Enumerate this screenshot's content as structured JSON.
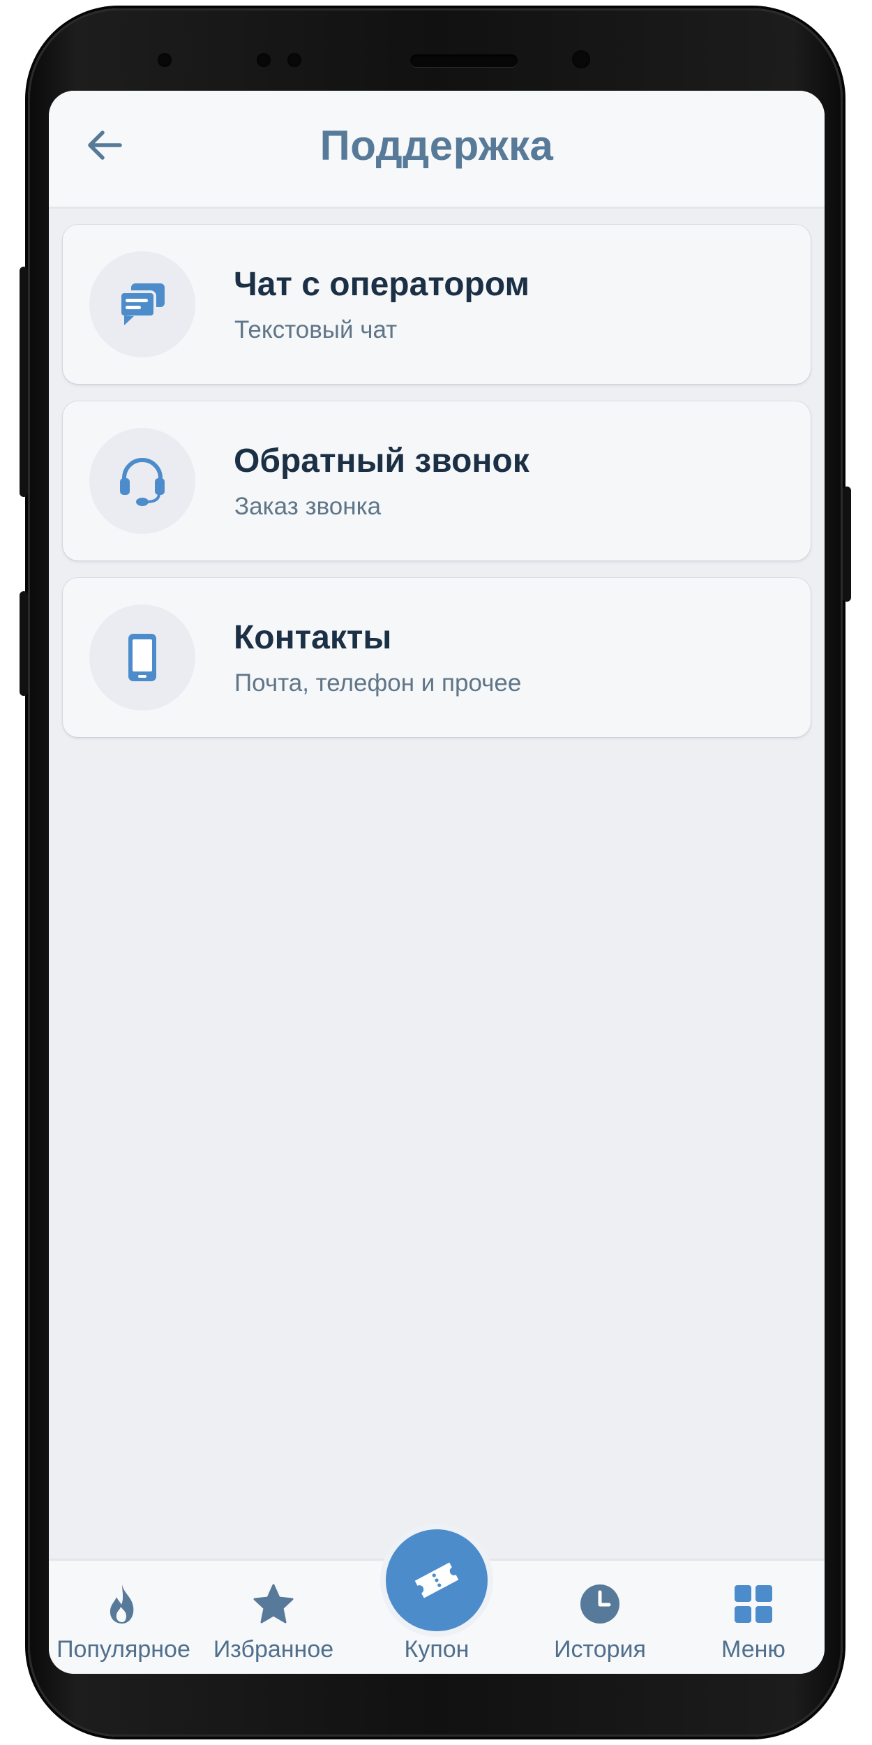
{
  "header": {
    "title": "Поддержка",
    "back_icon": "arrow-left-icon"
  },
  "menu": {
    "items": [
      {
        "title": "Чат с оператором",
        "subtitle": "Текстовый чат",
        "icon": "chat-bubbles-icon"
      },
      {
        "title": "Обратный звонок",
        "subtitle": "Заказ звонка",
        "icon": "headset-icon"
      },
      {
        "title": "Контакты",
        "subtitle": "Почта, телефон и прочее",
        "icon": "smartphone-icon"
      }
    ]
  },
  "bottom_nav": {
    "items": [
      {
        "label": "Популярное",
        "icon": "flame-icon"
      },
      {
        "label": "Избранное",
        "icon": "star-icon"
      },
      {
        "label": "Купон",
        "icon": "ticket-icon"
      },
      {
        "label": "История",
        "icon": "clock-icon"
      },
      {
        "label": "Меню",
        "icon": "grid-icon"
      }
    ]
  },
  "colors": {
    "accent": "#4d8ccb",
    "title": "#577a98",
    "text_primary": "#1b2f45",
    "text_secondary": "#5f7588",
    "background": "#edeff3"
  }
}
